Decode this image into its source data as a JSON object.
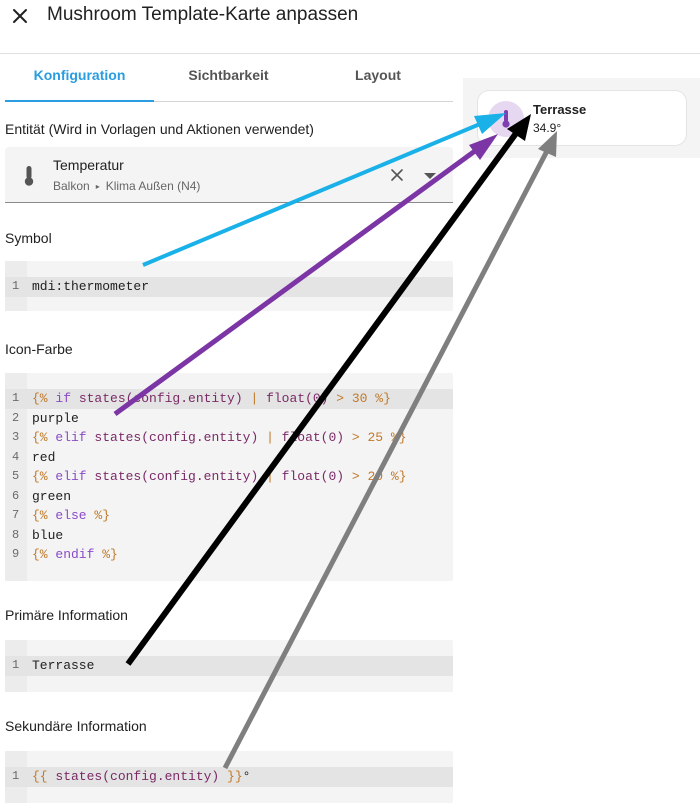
{
  "header": {
    "title": "Mushroom Template-Karte anpassen"
  },
  "tabs": [
    {
      "label": "Konfiguration",
      "active": true
    },
    {
      "label": "Sichtbarkeit",
      "active": false
    },
    {
      "label": "Layout",
      "active": false
    }
  ],
  "entity": {
    "label": "Entität (Wird in Vorlagen und Aktionen verwendet)",
    "name": "Temperatur",
    "area": "Balkon",
    "separator": "▸",
    "device": "Klima Außen (N4)"
  },
  "symbol": {
    "label": "Symbol",
    "lines": [
      "mdi:thermometer"
    ]
  },
  "icon_color": {
    "label": "Icon-Farbe",
    "lines": [
      "{% if states(config.entity) | float(0) > 30 %}",
      "purple",
      "{% elif states(config.entity) | float(0) > 25 %}",
      "red",
      "{% elif states(config.entity) | float(0) > 20 %}",
      "green",
      "{% else %}",
      "blue",
      "{% endif %}"
    ]
  },
  "primary": {
    "label": "Primäre Information",
    "lines": [
      "Terrasse"
    ]
  },
  "secondary": {
    "label": "Sekundäre Information",
    "lines": [
      "{{ states(config.entity) }}°"
    ]
  },
  "card": {
    "primary": "Terrasse",
    "secondary": "34.9°",
    "icon": "thermometer-icon",
    "icon_color": "#7e3fb0",
    "icon_bg": "#e5d8f0"
  },
  "colors": {
    "accent": "#2a9de0",
    "arrow_blue": "#1ab0e8",
    "arrow_purple": "#7b35a4",
    "arrow_black": "#000000",
    "arrow_gray": "#7f7f7f"
  }
}
